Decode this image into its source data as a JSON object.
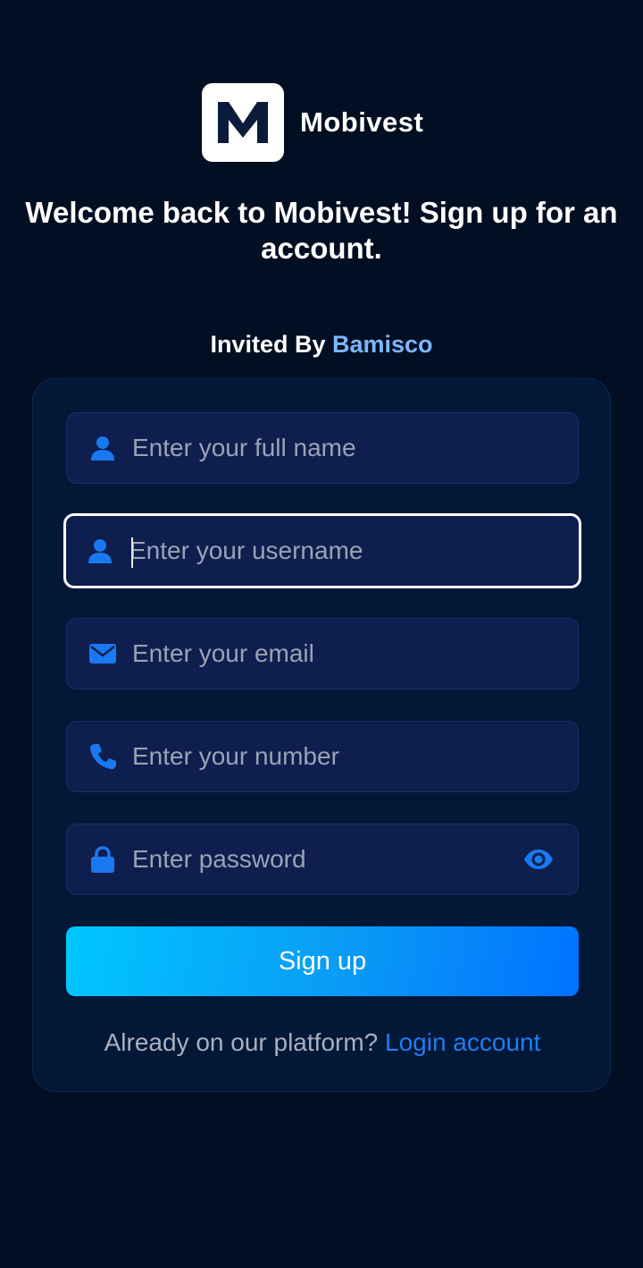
{
  "brand": {
    "name": "Mobivest",
    "logo_icon": "m-logo-icon"
  },
  "headline": "Welcome back to Mobivest! Sign up for an account.",
  "invite": {
    "prefix": "Invited By",
    "inviter": "Bamisco"
  },
  "form": {
    "full_name": {
      "placeholder": "Enter your full name",
      "value": "",
      "icon": "user-icon"
    },
    "username": {
      "placeholder": "Enter your username",
      "value": "",
      "icon": "user-icon"
    },
    "email": {
      "placeholder": "Enter your email",
      "value": "",
      "icon": "envelope-icon"
    },
    "phone": {
      "placeholder": "Enter your number",
      "value": "",
      "icon": "phone-icon"
    },
    "password": {
      "placeholder": "Enter password",
      "value": "",
      "icon": "lock-icon",
      "toggle_icon": "eye-icon"
    },
    "submit_label": "Sign up"
  },
  "footer": {
    "prompt": "Already on our platform?",
    "link_label": "Login account"
  },
  "colors": {
    "background": "#020f22",
    "card": "#031836",
    "field": "#0e1e4e",
    "accent": "#1f7cf2",
    "inviter": "#7ab8ff",
    "button_gradient_start": "#00c6ff",
    "button_gradient_end": "#0072ff"
  }
}
